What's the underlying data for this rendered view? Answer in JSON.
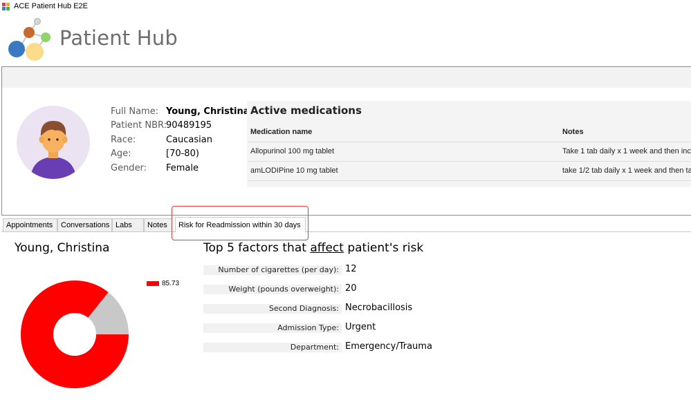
{
  "window": {
    "title": "ACE Patient Hub E2E"
  },
  "brand": {
    "name": "Patient Hub"
  },
  "patient": {
    "fields": [
      {
        "label": "Full Name:",
        "value": "Young, Christina"
      },
      {
        "label": "Patient NBR:",
        "value": "90489195"
      },
      {
        "label": "Race:",
        "value": "Caucasian"
      },
      {
        "label": "Age:",
        "value": "[70-80)"
      },
      {
        "label": "Gender:",
        "value": "Female"
      }
    ]
  },
  "medications": {
    "title": "Active medications",
    "columns": [
      "Medication name",
      "Notes"
    ],
    "rows": [
      [
        "Allopurinol 100 mg tablet",
        "Take 1 tab daily x 1 week and then inc"
      ],
      [
        "amLODIPine 10 mg tablet",
        "take 1/2 tab daily x 1 week and then ta"
      ]
    ]
  },
  "tabs": [
    {
      "label": "Appointments",
      "active": false
    },
    {
      "label": "Conversations",
      "active": false
    },
    {
      "label": "Labs",
      "active": false
    },
    {
      "label": "Notes",
      "active": false
    },
    {
      "label": "Risk for Readmission within 30 days",
      "active": true
    }
  ],
  "risk": {
    "patient_name": "Young, Christina",
    "factors_title_pre": "Top 5 factors that ",
    "factors_title_em": "affect",
    "factors_title_post": " patient's risk",
    "factors": [
      {
        "label": "Number of cigarettes (per day):",
        "value": "12"
      },
      {
        "label": "Weight (pounds overweight):",
        "value": "20"
      },
      {
        "label": "Second Diagnosis:",
        "value": "Necrobacillosis"
      },
      {
        "label": "Admission Type:",
        "value": "Urgent"
      },
      {
        "label": "Department:",
        "value": "Emergency/Trauma"
      }
    ]
  },
  "chart_data": {
    "type": "pie",
    "categories": [
      "85.73",
      ""
    ],
    "values": [
      85.73,
      14.27
    ],
    "colors": [
      "#ff0000",
      "#c8c8c8"
    ],
    "legend": [
      "85.73"
    ],
    "legend_placement": "top-right",
    "donut": true
  },
  "colors": {
    "risk": "#ff0000",
    "remainder": "#c8c8c8",
    "highlight": "#e23c3c"
  }
}
